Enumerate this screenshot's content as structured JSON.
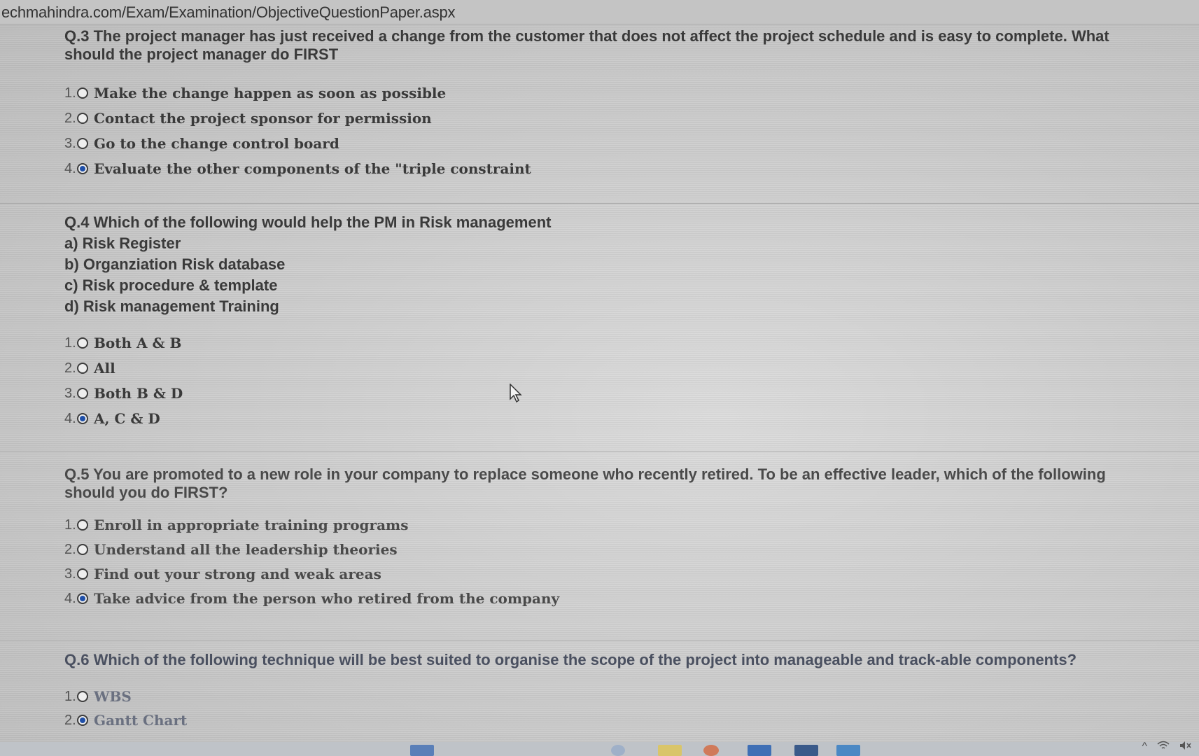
{
  "browser": {
    "url": "echmahindra.com/Exam/Examination/ObjectiveQuestionPaper.aspx"
  },
  "questions": [
    {
      "text": "Q.3 The project manager has just received a change from the customer that does not affect the project schedule and is easy to complete. What should the project manager do FIRST",
      "options": [
        {
          "num": "1.",
          "label": "Make the change happen as soon as possible",
          "checked": false
        },
        {
          "num": "2.",
          "label": "Contact the project sponsor for permission",
          "checked": false
        },
        {
          "num": "3.",
          "label": "Go to the change control board",
          "checked": false
        },
        {
          "num": "4.",
          "label": "Evaluate the other components of the \"triple constraint",
          "checked": true
        }
      ]
    },
    {
      "text": "Q.4 Which of the following would help the PM in Risk management",
      "subitems": [
        "a) Risk Register",
        "b) Organziation Risk database",
        "c) Risk procedure & template",
        "d) Risk management Training"
      ],
      "options": [
        {
          "num": "1.",
          "label": "Both A & B",
          "checked": false
        },
        {
          "num": "2.",
          "label": "All",
          "checked": false
        },
        {
          "num": "3.",
          "label": "Both B & D",
          "checked": false
        },
        {
          "num": "4.",
          "label": "A, C & D",
          "checked": true
        }
      ]
    },
    {
      "text": "Q.5 You are promoted to a new role in your company to replace someone who recently retired. To be an effective leader, which of the following should you do FIRST?",
      "options": [
        {
          "num": "1.",
          "label": "Enroll in appropriate training programs",
          "checked": false
        },
        {
          "num": "2.",
          "label": "Understand all the leadership theories",
          "checked": false
        },
        {
          "num": "3.",
          "label": "Find out your strong and weak areas",
          "checked": false
        },
        {
          "num": "4.",
          "label": "Take advice from the person who retired from the company",
          "checked": true
        }
      ]
    },
    {
      "text": "Q.6 Which of the following technique will be best suited to organise the scope of the project into manageable and track-able components?",
      "options": [
        {
          "num": "1.",
          "label": "WBS",
          "checked": false
        },
        {
          "num": "2.",
          "label": "Gantt Chart",
          "checked": true
        }
      ]
    }
  ],
  "colors": {
    "radio_selected": "#1f4fa8",
    "text": "#3a3a3a"
  },
  "icons": {
    "cursor": "mouse-pointer-icon",
    "wifi": "wifi-icon",
    "volume": "volume-muted-icon",
    "chevron": "chevron-up-icon"
  }
}
